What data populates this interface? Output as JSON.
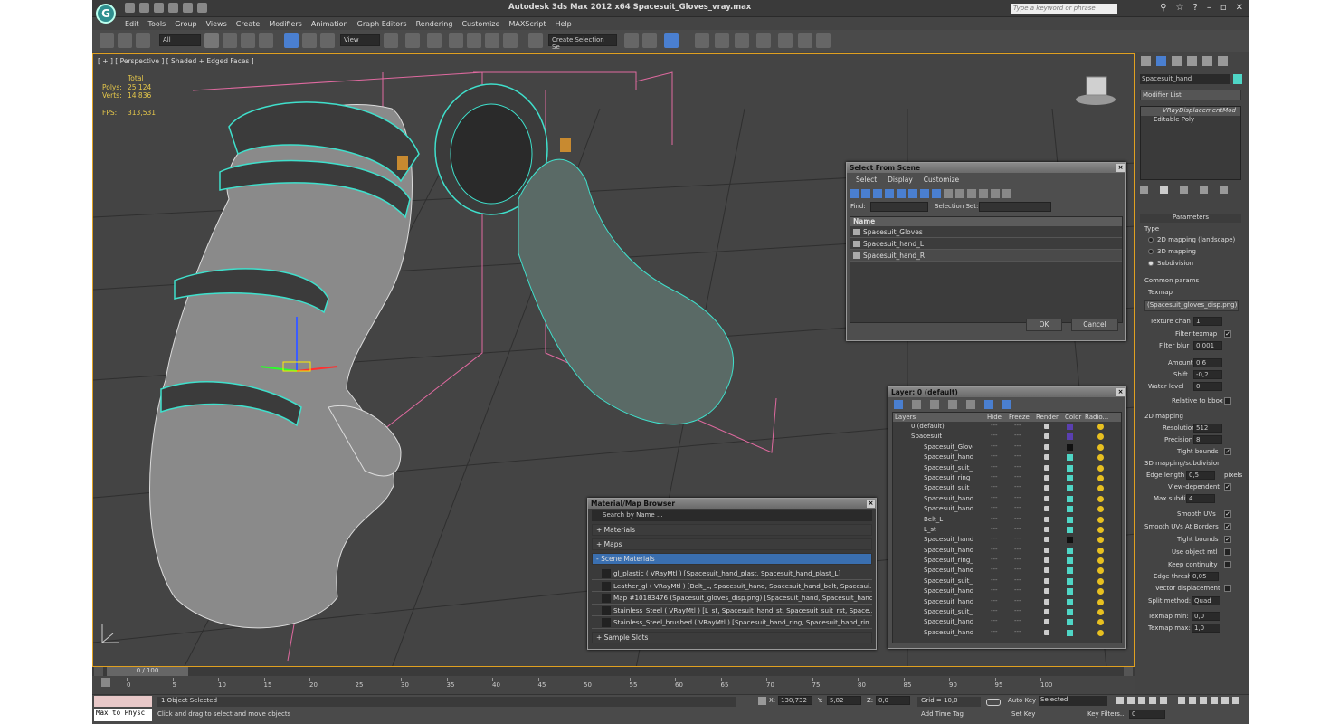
{
  "app": {
    "title": "Autodesk 3ds Max  2012 x64      Spacesuit_Gloves_vray.max",
    "logo": "G",
    "search_placeholder": "Type a keyword or phrase"
  },
  "menu": [
    "Edit",
    "Tools",
    "Group",
    "Views",
    "Create",
    "Modifiers",
    "Animation",
    "Graph Editors",
    "Rendering",
    "Customize",
    "MAXScript",
    "Help"
  ],
  "toolbar": {
    "filter": "All",
    "refcoord": "View",
    "named_sel": "Create Selection Se"
  },
  "viewport": {
    "label": "[ + ] [ Perspective ] [ Shaded + Edged Faces ]",
    "stats": {
      "total": "Total",
      "polys_label": "Polys:",
      "polys": "25 124",
      "verts_label": "Verts:",
      "verts": "14 836",
      "fps_label": "FPS:",
      "fps": "313,531"
    }
  },
  "select_from_scene": {
    "title": "Select From Scene",
    "menu": [
      "Select",
      "Display",
      "Customize"
    ],
    "find_label": "Find:",
    "selset_label": "Selection Set:",
    "col_name": "Name",
    "items": [
      "Spacesuit_Gloves",
      "Spacesuit_hand_L",
      "Spacesuit_hand_R"
    ],
    "ok": "OK",
    "cancel": "Cancel"
  },
  "layer": {
    "title": "Layer: 0 (default)",
    "cols": [
      "Layers",
      "Hide",
      "Freeze",
      "Render",
      "Color",
      "Radio..."
    ],
    "rows": [
      {
        "name": "0 (default)",
        "color": "#5a3fb0",
        "indent": 0
      },
      {
        "name": "Spacesuit",
        "color": "#5a3fb0",
        "indent": 0
      },
      {
        "name": "Spacesuit_Glove",
        "color": "#111111",
        "indent": 1
      },
      {
        "name": "Spacesuit_hand_",
        "color": "#4fd6c6",
        "indent": 1
      },
      {
        "name": "Spacesuit_suit_r",
        "color": "#4fd6c6",
        "indent": 1
      },
      {
        "name": "Spacesuit_ring_f",
        "color": "#4fd6c6",
        "indent": 1
      },
      {
        "name": "Spacesuit_suit_r",
        "color": "#4fd6c6",
        "indent": 1
      },
      {
        "name": "Spacesuit_hand_",
        "color": "#4fd6c6",
        "indent": 1
      },
      {
        "name": "Spacesuit_hand_",
        "color": "#4fd6c6",
        "indent": 1
      },
      {
        "name": "Belt_L",
        "color": "#4fd6c6",
        "indent": 1
      },
      {
        "name": "L_st",
        "color": "#4fd6c6",
        "indent": 1
      },
      {
        "name": "Spacesuit_hand_",
        "color": "#111111",
        "indent": 1
      },
      {
        "name": "Spacesuit_hand_",
        "color": "#4fd6c6",
        "indent": 1
      },
      {
        "name": "Spacesuit_ring_f",
        "color": "#4fd6c6",
        "indent": 1
      },
      {
        "name": "Spacesuit_hand",
        "color": "#4fd6c6",
        "indent": 1
      },
      {
        "name": "Spacesuit_suit_r",
        "color": "#4fd6c6",
        "indent": 1
      },
      {
        "name": "Spacesuit_hand_",
        "color": "#4fd6c6",
        "indent": 1
      },
      {
        "name": "Spacesuit_hand_",
        "color": "#4fd6c6",
        "indent": 1
      },
      {
        "name": "Spacesuit_suit_r",
        "color": "#4fd6c6",
        "indent": 1
      },
      {
        "name": "Spacesuit_hand_",
        "color": "#4fd6c6",
        "indent": 1
      },
      {
        "name": "Spacesuit_hand_",
        "color": "#4fd6c6",
        "indent": 1
      }
    ]
  },
  "material_browser": {
    "title": "Material/Map Browser",
    "search": "Search by Name ...",
    "groups": {
      "materials": "+ Materials",
      "maps": "+ Maps",
      "scene": "- Scene Materials",
      "samples": "+ Sample Slots"
    },
    "items": [
      "gl_plastic  ( VRayMtl ) [Spacesuit_hand_plast, Spacesuit_hand_plast_L]",
      "Leather_gl  ( VRayMtl ) [Belt_L, Spacesuit_hand, Spacesuit_hand_belt, Spacesui...",
      "Map #10183476 (Spacesuit_gloves_disp.png) [Spacesuit_hand, Spacesuit_hand_l]",
      "Stainless_Steel  ( VRayMtl ) [L_st, Spacesuit_hand_st, Spacesuit_suit_rst, Space...",
      "Stainless_Steel_brushed  ( VRayMtl ) [Spacesuit_hand_ring, Spacesuit_hand_rin..."
    ]
  },
  "command_panel": {
    "object_name": "Spacesuit_hand",
    "modifier_list": "Modifier List",
    "stack": [
      "VRayDisplacementMod",
      "Editable Poly"
    ],
    "params_title": "Parameters",
    "type_label": "Type",
    "radios": [
      "2D mapping (landscape)",
      "3D mapping",
      "Subdivision"
    ],
    "common": "Common params",
    "texmap": "Texmap",
    "texmap_file": "(Spacesuit_gloves_disp.png)",
    "texture_chan": "Texture chan",
    "texture_chan_val": "1",
    "filter_texmap": "Filter texmap",
    "filter_blur": "Filter blur",
    "filter_blur_val": "0,001",
    "amount": "Amount",
    "amount_val": "0,6",
    "shift": "Shift",
    "shift_val": "-0,2",
    "water": "Water level",
    "water_val": "0",
    "relative": "Relative to bbox",
    "map2d": "2D mapping",
    "resolution": "Resolution",
    "resolution_val": "512",
    "precision": "Precision",
    "precision_val": "8",
    "tight": "Tight bounds",
    "map3d": "3D mapping/subdivision",
    "edge_len": "Edge length",
    "edge_len_val": "0,5",
    "pixels": "pixels",
    "view_dep": "View-dependent",
    "max_subdivs": "Max subdivs",
    "max_subdivs_val": "4",
    "smooth_uvs": "Smooth UVs",
    "smooth_borders": "Smooth UVs At Borders",
    "tight2": "Tight bounds",
    "use_obj": "Use object mtl",
    "keep_cont": "Keep continuity",
    "edge_thresh": "Edge thresh",
    "edge_thresh_val": "0,05",
    "vector_disp": "Vector displacement",
    "split": "Split method:",
    "split_val": "Quad",
    "texmap_min": "Texmap min:",
    "texmap_min_val": "0,0",
    "texmap_max": "Texmap max:",
    "texmap_max_val": "1,0"
  },
  "timeline": {
    "frame": "0 / 100",
    "ticks": [
      "0",
      "5",
      "10",
      "15",
      "20",
      "25",
      "30",
      "35",
      "40",
      "45",
      "50",
      "55",
      "60",
      "65",
      "70",
      "75",
      "80",
      "85",
      "90",
      "95",
      "100"
    ]
  },
  "status": {
    "maxscript": "Max to Physc",
    "selected": "1 Object Selected",
    "prompt": "Click and drag to select and move objects",
    "x_label": "X:",
    "x": "130,732",
    "y_label": "Y:",
    "y": "5,82",
    "z_label": "Z:",
    "z": "0,0",
    "grid": "Grid = 10,0",
    "add_time": "Add Time Tag",
    "autokey": "Auto Key",
    "setkey": "Set Key",
    "sel_mode": "Selected",
    "key_filters": "Key Filters...",
    "frame_field": "0"
  }
}
